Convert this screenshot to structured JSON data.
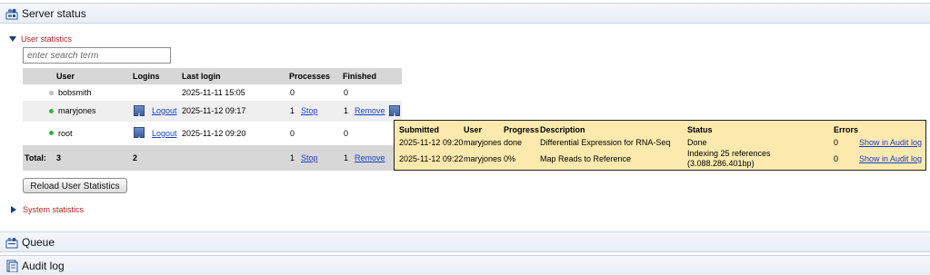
{
  "server_status": {
    "title": "Server status"
  },
  "user_statistics": {
    "label": "User statistics",
    "search_placeholder": "enter search term",
    "columns": [
      "User",
      "Logins",
      "Last login",
      "Processes",
      "Finished"
    ],
    "rows": [
      {
        "user": "bobsmith",
        "status": "offline",
        "logins": "",
        "logout": "",
        "last_login": "2025-11-11 15:05",
        "processes": "0",
        "stop": "",
        "finished": "0",
        "remove": ""
      },
      {
        "user": "maryjones",
        "status": "online",
        "logins": "",
        "logout": "Logout",
        "last_login": "2025-11-12 09:17",
        "processes": "1",
        "stop": "Stop",
        "finished": "1",
        "remove": "Remove"
      },
      {
        "user": "root",
        "status": "online",
        "logins": "",
        "logout": "Logout",
        "last_login": "2025-11-12 09:20",
        "processes": "0",
        "stop": "",
        "finished": "0",
        "remove": ""
      }
    ],
    "total": {
      "label": "Total:",
      "users": "3",
      "logins": "2",
      "processes": "1",
      "stop": "Stop",
      "finished": "1",
      "remove": "Remove"
    },
    "reload_label": "Reload User Statistics"
  },
  "tooltip": {
    "columns": [
      "Submitted",
      "User",
      "Progress",
      "Description",
      "Status",
      "Errors"
    ],
    "rows": [
      {
        "submitted": "2025-11-12 09:20",
        "user": "maryjones",
        "progress": "done",
        "description": "Differential Expression for RNA-Seq",
        "status_line1": "Done",
        "status_line2": "",
        "errors": "0",
        "link": "Show in Audit log"
      },
      {
        "submitted": "2025-11-12 09:22",
        "user": "maryjones",
        "progress": "0%",
        "description": "Map Reads to Reference",
        "status_line1": "Indexing 25 references",
        "status_line2": "(3.088.286.401bp)",
        "errors": "0",
        "link": "Show in Audit log"
      }
    ]
  },
  "system_statistics": {
    "label": "System statistics"
  },
  "queue": {
    "title": "Queue"
  },
  "audit_log": {
    "title": "Audit log"
  },
  "info_glyph": "i"
}
